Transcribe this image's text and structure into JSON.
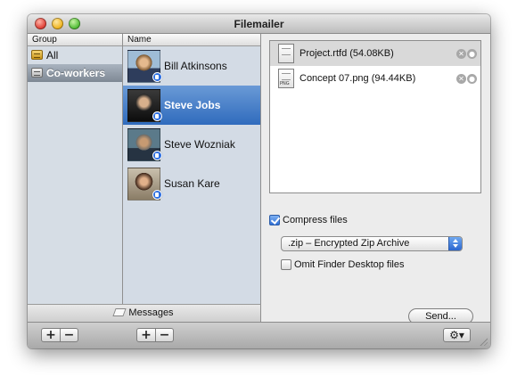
{
  "window": {
    "title": "Filemailer"
  },
  "groups": {
    "header": "Group",
    "items": [
      {
        "label": "All",
        "icon": "address-book-icon",
        "selected": false
      },
      {
        "label": "Co-workers",
        "icon": "group-card-icon",
        "selected": true
      }
    ]
  },
  "contacts": {
    "header": "Name",
    "items": [
      {
        "name": "Bill Atkinsons",
        "selected": false
      },
      {
        "name": "Steve Jobs",
        "selected": true
      },
      {
        "name": "Steve Wozniak",
        "selected": false
      },
      {
        "name": "Susan Kare",
        "selected": false
      }
    ]
  },
  "messages": {
    "label": "Messages"
  },
  "files": [
    {
      "name": "Project.rtfd (54.08KB)",
      "tag": "",
      "selected": true
    },
    {
      "name": "Concept 07.png (94.44KB)",
      "tag": "PNG",
      "selected": false
    }
  ],
  "options": {
    "compress_label": "Compress files",
    "compress_checked": true,
    "format_value": ".zip – Encrypted Zip Archive",
    "omit_label": "Omit Finder Desktop files",
    "omit_checked": false
  },
  "send_label": "Send...",
  "toolbar": {
    "add_label": "+",
    "remove_label": "−",
    "gear_label": "⚙▾"
  }
}
